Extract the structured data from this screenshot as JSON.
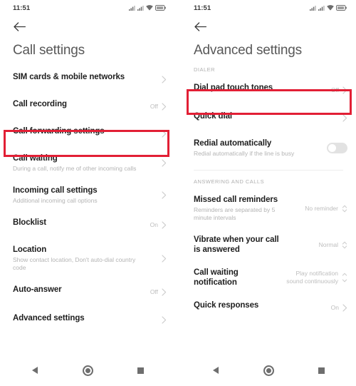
{
  "status_bar": {
    "time": "11:51",
    "icons": [
      "signal-bars-icon",
      "signal-bars-icon",
      "wifi-icon",
      "battery-icon"
    ]
  },
  "highlight_color": "#e21f35",
  "left_screen": {
    "back_icon": "back-arrow-icon",
    "title": "Call settings",
    "items": [
      {
        "title": "SIM cards & mobile networks",
        "subtitle": "",
        "value": "",
        "control": "chevron"
      },
      {
        "title": "Call recording",
        "subtitle": "",
        "value": "Off",
        "control": "chevron"
      },
      {
        "title": "Call forwarding settings",
        "subtitle": "",
        "value": "",
        "control": "chevron"
      },
      {
        "title": "Call waiting",
        "subtitle": "During a call, notify me of other incoming calls",
        "value": "",
        "control": "chevron"
      },
      {
        "title": "Incoming call settings",
        "subtitle": "Additional incoming call options",
        "value": "",
        "control": "chevron"
      },
      {
        "title": "Blocklist",
        "subtitle": "",
        "value": "On",
        "control": "chevron"
      },
      {
        "title": "Location",
        "subtitle": "Show contact location, Don't auto-dial country code",
        "value": "",
        "control": "chevron"
      },
      {
        "title": "Auto-answer",
        "subtitle": "",
        "value": "Off",
        "control": "chevron"
      },
      {
        "title": "Advanced settings",
        "subtitle": "",
        "value": "",
        "control": "chevron",
        "highlighted": true
      }
    ]
  },
  "right_screen": {
    "back_icon": "back-arrow-icon",
    "title": "Advanced settings",
    "section_dialer": "DIALER",
    "section_answering": "ANSWERING AND CALLS",
    "dialer_items": [
      {
        "title": "Dial pad touch tones",
        "subtitle": "",
        "value": "Off",
        "control": "chevron"
      },
      {
        "title": "Quick dial",
        "subtitle": "",
        "value": "",
        "control": "chevron",
        "highlighted": true
      },
      {
        "title": "Redial automatically",
        "subtitle": "Redial automatically if the line is busy",
        "value": "",
        "control": "toggle",
        "toggle_on": false
      }
    ],
    "answering_items": [
      {
        "title": "Missed call reminders",
        "subtitle": "Reminders are separated by 5 minute intervals",
        "value": "No reminder",
        "control": "stepper"
      },
      {
        "title": "Vibrate when your call is answered",
        "subtitle": "",
        "value": "Normal",
        "control": "stepper"
      },
      {
        "title": "Call waiting notification",
        "subtitle": "",
        "value": "Play notification sound continuously",
        "control": "stepper"
      },
      {
        "title": "Quick responses",
        "subtitle": "",
        "value": "On",
        "control": "chevron"
      }
    ]
  },
  "nav_bar": {
    "back": "nav-back-icon",
    "home": "nav-home-icon",
    "recents": "nav-recents-icon"
  }
}
